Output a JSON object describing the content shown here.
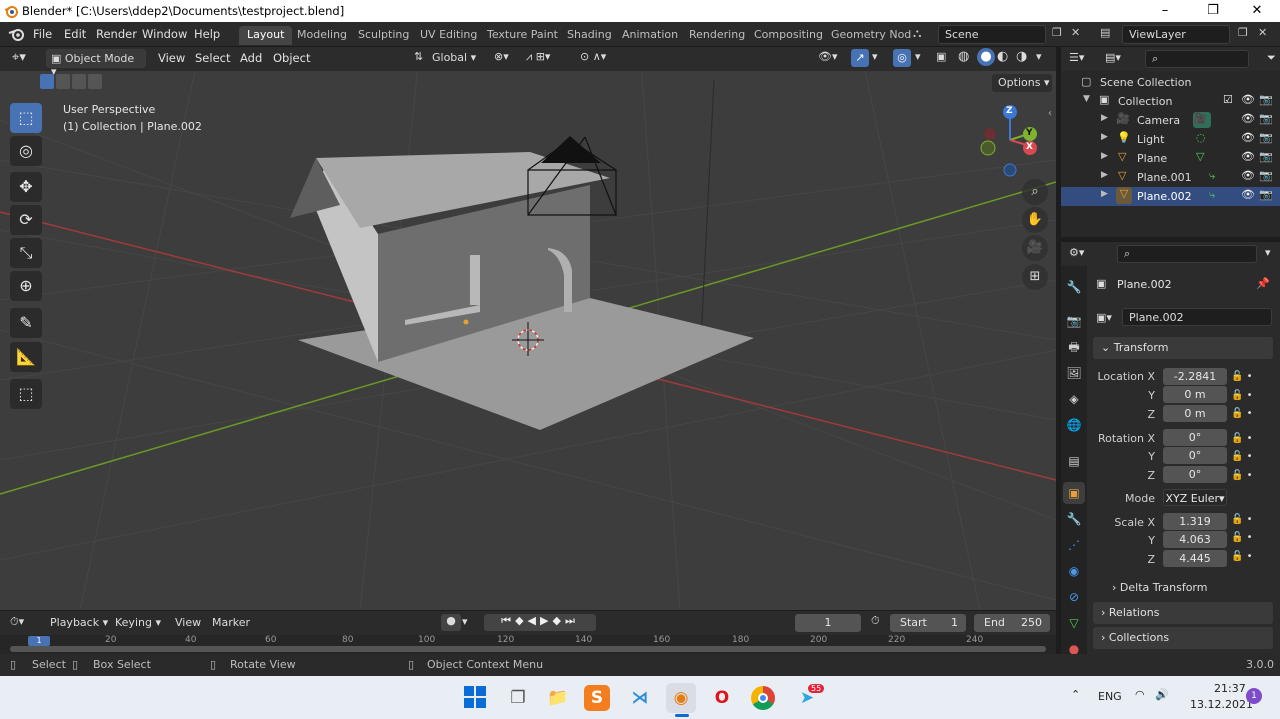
{
  "window": {
    "title": "Blender* [C:\\Users\\ddep2\\Documents\\testproject.blend]",
    "min": "–",
    "max": "❐",
    "close": "✕"
  },
  "menubar": {
    "items": [
      "File",
      "Edit",
      "Render",
      "Window",
      "Help"
    ]
  },
  "workspaces": {
    "tabs": [
      "Layout",
      "Modeling",
      "Sculpting",
      "UV Editing",
      "Texture Paint",
      "Shading",
      "Animation",
      "Rendering",
      "Compositing",
      "Geometry Nod"
    ],
    "active": "Layout"
  },
  "scene": {
    "label": "Scene",
    "viewlayer": "ViewLayer"
  },
  "viewport_header": {
    "mode": "Object Mode",
    "menus": [
      "View",
      "Select",
      "Add",
      "Object"
    ],
    "orientation": "Global",
    "options": "Options"
  },
  "viewport": {
    "view_name": "User Perspective",
    "collection_info": "(1) Collection | Plane.002",
    "gizmo": {
      "x": "X",
      "y": "Y",
      "z": "Z"
    }
  },
  "outliner": {
    "root": "Scene Collection",
    "collection": "Collection",
    "items": [
      "Camera",
      "Light",
      "Plane",
      "Plane.001",
      "Plane.002"
    ],
    "selected": "Plane.002"
  },
  "properties": {
    "object_name": "Plane.002",
    "data_name": "Plane.002",
    "transform_label": "Transform",
    "location": {
      "label": "Location X",
      "x": "-2.2841",
      "y": "0 m",
      "z": "0 m"
    },
    "rotation": {
      "label": "Rotation X",
      "x": "0°",
      "y": "0°",
      "z": "0°"
    },
    "mode": {
      "label": "Mode",
      "value": "XYZ Euler"
    },
    "scale": {
      "label": "Scale X",
      "x": "1.319",
      "y": "4.063",
      "z": "4.445"
    },
    "axis_y": "Y",
    "axis_z": "Z",
    "delta": "Delta Transform",
    "relations": "Relations",
    "collections": "Collections"
  },
  "timeline": {
    "menus": [
      "Playback",
      "Keying",
      "View",
      "Marker"
    ],
    "current_frame": "1",
    "start_label": "Start",
    "start": "1",
    "end_label": "End",
    "end": "250",
    "ticks": [
      "1",
      "20",
      "40",
      "60",
      "80",
      "100",
      "120",
      "140",
      "160",
      "180",
      "200",
      "220",
      "240"
    ]
  },
  "statusbar": {
    "select": "Select",
    "box_select": "Box Select",
    "rotate_view": "Rotate View",
    "context_menu": "Object Context Menu",
    "version": "3.0.0"
  },
  "taskbar": {
    "lang": "ENG",
    "time": "21:37",
    "date": "13.12.2021",
    "notification_count": "1",
    "telegram_badge": "55"
  },
  "colors": {
    "accent": "#4772b3",
    "x_axis": "#c0393b",
    "y_axis": "#6a9a23",
    "selection": "#e8a13a"
  }
}
